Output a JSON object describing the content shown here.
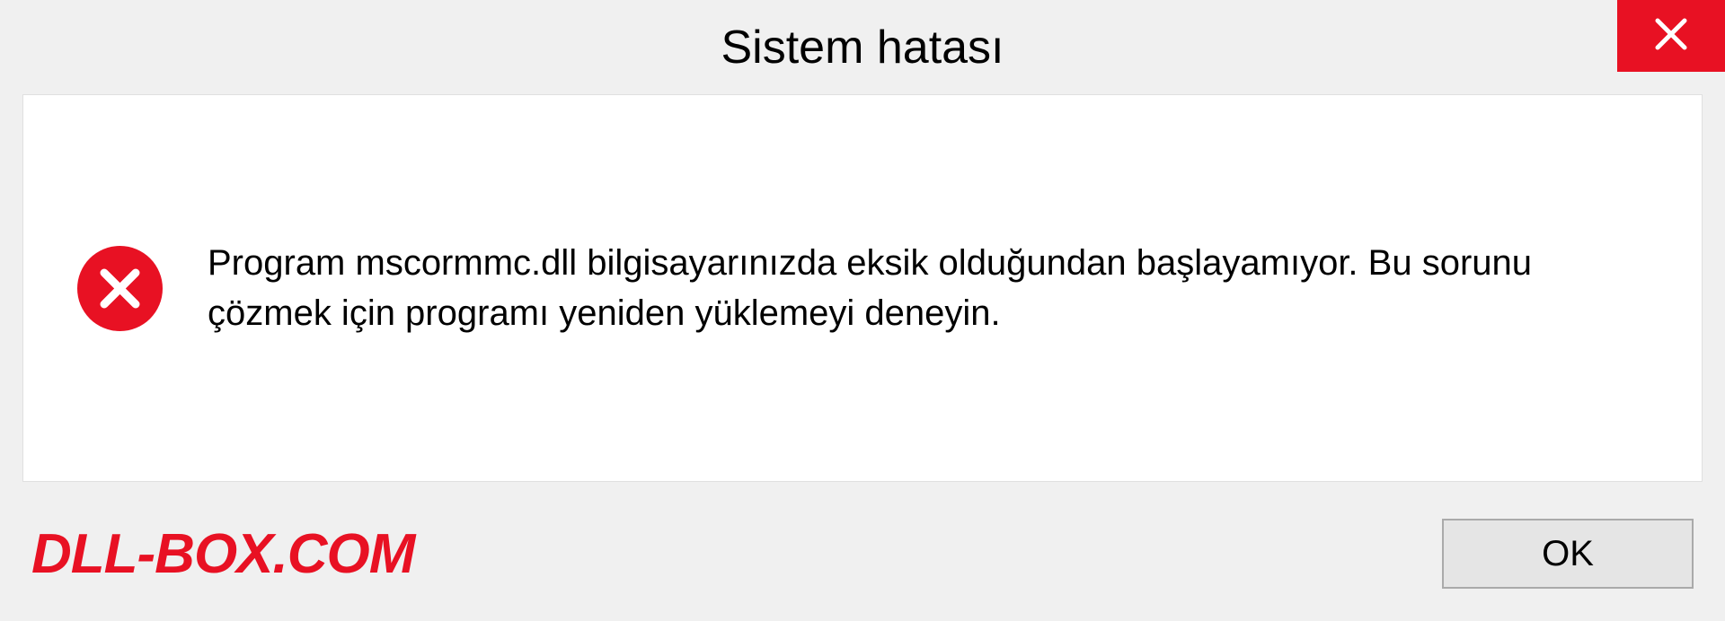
{
  "dialog": {
    "title": "Sistem hatası",
    "message": "Program mscormmc.dll bilgisayarınızda eksik olduğundan başlayamıyor. Bu sorunu çözmek için programı yeniden yüklemeyi deneyin.",
    "ok_label": "OK"
  },
  "watermark": "DLL-BOX.COM"
}
